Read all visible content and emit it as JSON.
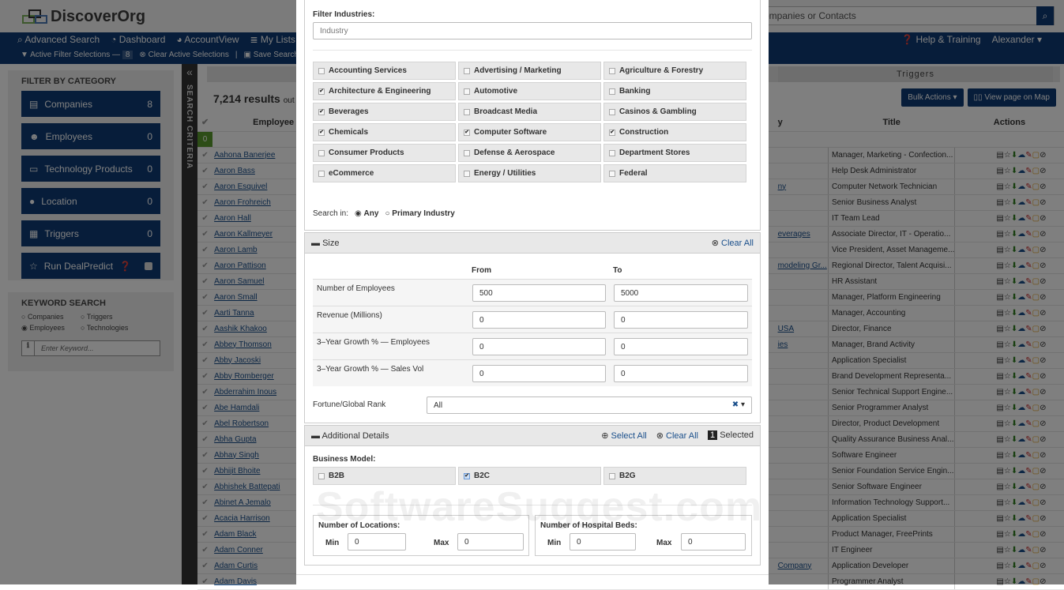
{
  "app": {
    "brand": "DiscoverOrg",
    "search_placeholder": "Search for Companies or Contacts",
    "search_visible_text": "ompanies or Contacts"
  },
  "nav": {
    "items": [
      {
        "label": "Advanced Search",
        "icon": "search-icon"
      },
      {
        "label": "Dashboard",
        "icon": "dashboard-icon"
      },
      {
        "label": "AccountView",
        "icon": "pie-icon"
      },
      {
        "label": "My Lists",
        "icon": "list-icon"
      }
    ],
    "sub": {
      "active_filters": "Active Filter Selections —",
      "active_count": "8",
      "clear": "Clear Active Selections",
      "sep": "|",
      "save": "Save Search"
    },
    "help": "Help & Training",
    "user": "Alexander"
  },
  "sidebar": {
    "title": "FILTER BY CATEGORY",
    "categories": [
      {
        "label": "Companies",
        "count": "8",
        "icon": "building-icon"
      },
      {
        "label": "Employees",
        "count": "0",
        "icon": "users-icon"
      },
      {
        "label": "Technology Products",
        "count": "0",
        "icon": "laptop-icon"
      },
      {
        "label": "Location",
        "count": "0",
        "icon": "map-pin-icon"
      },
      {
        "label": "Triggers",
        "count": "0",
        "icon": "news-icon"
      },
      {
        "label": "Run DealPredict",
        "count": "",
        "icon": "star-icon"
      }
    ]
  },
  "keyword": {
    "title": "KEYWORD SEARCH",
    "options": [
      "Companies",
      "Triggers",
      "Employees",
      "Technologies"
    ],
    "selected": "Employees",
    "placeholder": "Enter Keyword..."
  },
  "search_criteria_label": "SEARCH CRITERIA",
  "results": {
    "count": "7,214 results",
    "suffix": "out of",
    "tab_triggers": "Triggers",
    "bulk_actions": "Bulk Actions",
    "view_map": "View page on Map",
    "columns": {
      "employee": "Employee",
      "company_partial": "y",
      "title": "Title",
      "actions": "Actions"
    },
    "selected_count": "0",
    "rows": [
      {
        "name": "Aahona Banerjee",
        "company": "",
        "title": "Manager, Marketing - Confection..."
      },
      {
        "name": "Aaron Bass",
        "company": "",
        "title": "Help Desk Administrator"
      },
      {
        "name": "Aaron Esquivel",
        "company": "ny",
        "title": "Computer Network Technician"
      },
      {
        "name": "Aaron Frohreich",
        "company": "",
        "title": "Senior Business Analyst"
      },
      {
        "name": "Aaron Hall",
        "company": "",
        "title": "IT Team Lead"
      },
      {
        "name": "Aaron Kallmeyer",
        "company": "everages",
        "title": "Associate Director, IT - Operatio..."
      },
      {
        "name": "Aaron Lamb",
        "company": "",
        "title": "Vice President, Asset Manageme..."
      },
      {
        "name": "Aaron Pattison",
        "company": "modeling Gr...",
        "title": "Regional Director, Talent Acquisi..."
      },
      {
        "name": "Aaron Samuel",
        "company": "",
        "title": "HR Assistant"
      },
      {
        "name": "Aaron Small",
        "company": "",
        "title": "Manager, Platform Engineering"
      },
      {
        "name": "Aarti Tanna",
        "company": "",
        "title": "Manager, Accounting"
      },
      {
        "name": "Aashik Khakoo",
        "company": "USA",
        "title": "Director, Finance"
      },
      {
        "name": "Abbey Thomson",
        "company": "ies",
        "title": "Manager, Brand Activity"
      },
      {
        "name": "Abby Jacoski",
        "company": "",
        "title": "Application Specialist"
      },
      {
        "name": "Abby Romberger",
        "company": "",
        "title": "Brand Development Representa..."
      },
      {
        "name": "Abderrahim Inous",
        "company": "",
        "title": "Senior Technical Support Engine..."
      },
      {
        "name": "Abe Hamdali",
        "company": "",
        "title": "Senior Programmer Analyst"
      },
      {
        "name": "Abel Robertson",
        "company": "",
        "title": "Director, Product Development"
      },
      {
        "name": "Abha Gupta",
        "company": "",
        "title": "Quality Assurance Business Anal..."
      },
      {
        "name": "Abhay Singh",
        "company": "",
        "title": "Software Engineer"
      },
      {
        "name": "Abhijit Bhoite",
        "company": "",
        "title": "Senior Foundation Service Engin..."
      },
      {
        "name": "Abhishek Battepati",
        "company": "",
        "title": "Senior Software Engineer"
      },
      {
        "name": "Abinet A Jemalo",
        "company": "",
        "title": "Information Technology Support..."
      },
      {
        "name": "Acacia Harrison",
        "company": "",
        "title": "Application Specialist"
      },
      {
        "name": "Adam Black",
        "company": "",
        "title": "Product Manager, FreePrints"
      },
      {
        "name": "Adam Conner",
        "company": "",
        "title": "IT Engineer"
      },
      {
        "name": "Adam Curtis",
        "company": "Company",
        "title": "Application Developer"
      },
      {
        "name": "Adam Davis",
        "company": "",
        "title": "Programmer Analyst"
      }
    ]
  },
  "modal": {
    "filter_industries_label": "Filter Industries:",
    "industry_placeholder": "Industry",
    "industries": [
      {
        "label": "Accounting Services",
        "checked": false
      },
      {
        "label": "Advertising / Marketing",
        "checked": false
      },
      {
        "label": "Agriculture & Forestry",
        "checked": false
      },
      {
        "label": "Architecture & Engineering",
        "checked": true
      },
      {
        "label": "Automotive",
        "checked": false
      },
      {
        "label": "Banking",
        "checked": false
      },
      {
        "label": "Beverages",
        "checked": true
      },
      {
        "label": "Broadcast Media",
        "checked": false
      },
      {
        "label": "Casinos & Gambling",
        "checked": false
      },
      {
        "label": "Chemicals",
        "checked": true
      },
      {
        "label": "Computer Software",
        "checked": true
      },
      {
        "label": "Construction",
        "checked": true
      },
      {
        "label": "Consumer Products",
        "checked": false
      },
      {
        "label": "Defense & Aerospace",
        "checked": false
      },
      {
        "label": "Department Stores",
        "checked": false
      },
      {
        "label": "eCommerce",
        "checked": false
      },
      {
        "label": "Energy / Utilities",
        "checked": false
      },
      {
        "label": "Federal",
        "checked": false
      }
    ],
    "search_in_label": "Search in:",
    "search_in_options": [
      "Any",
      "Primary Industry"
    ],
    "search_in_selected": "Any",
    "size": {
      "title": "Size",
      "clear_all": "Clear All",
      "from": "From",
      "to": "To",
      "rows": [
        {
          "label": "Number of Employees",
          "from": "500",
          "to": "5000"
        },
        {
          "label": "Revenue (Millions)",
          "from": "0",
          "to": "0"
        },
        {
          "label": "3–Year Growth % — Employees",
          "from": "0",
          "to": "0"
        },
        {
          "label": "3–Year Growth % — Sales Vol",
          "from": "0",
          "to": "0"
        }
      ],
      "rank_label": "Fortune/Global Rank",
      "rank_value": "All"
    },
    "additional": {
      "title": "Additional Details",
      "select_all": "Select All",
      "clear_all": "Clear All",
      "selected_count": "1",
      "selected_label": "Selected",
      "business_model_label": "Business Model:",
      "business_models": [
        {
          "label": "B2B",
          "checked": false
        },
        {
          "label": "B2C",
          "checked": true
        },
        {
          "label": "B2G",
          "checked": false
        }
      ],
      "locations": {
        "title": "Number of Locations:",
        "min_label": "Min",
        "min": "0",
        "max_label": "Max",
        "max": "0"
      },
      "beds": {
        "title": "Number of Hospital Beds:",
        "min_label": "Min",
        "min": "0",
        "max_label": "Max",
        "max": "0"
      }
    }
  },
  "watermark": "SoftwareSuggest.com"
}
